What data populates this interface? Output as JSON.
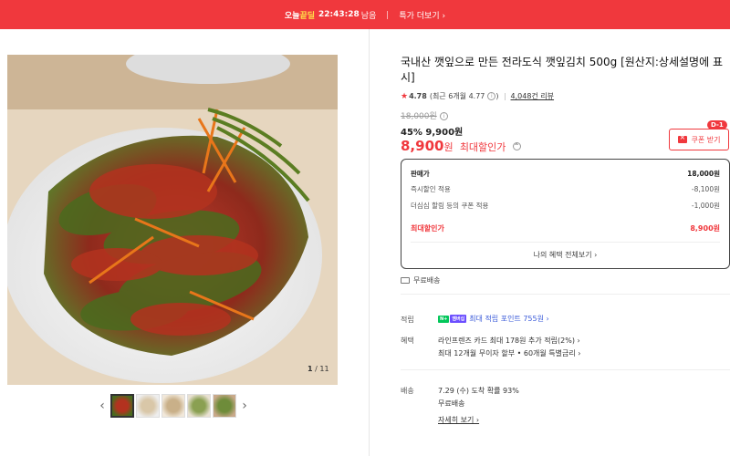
{
  "banner": {
    "brand_prefix": "오늘",
    "brand_highlight": "끝딜",
    "timer": "22:43:28",
    "timer_suffix": "남음",
    "more_link": "특가 더보기 ›"
  },
  "gallery": {
    "counter_current": "1",
    "counter_total": "/ 11",
    "thumb_count": 5
  },
  "product": {
    "title": "국내산 깻잎으로 만든 전라도식 깻잎김치 500g [원산지:상세설명에 표시]",
    "rating": "4.78",
    "rating_recent": "(최근 6개월 4.77",
    "rating_recent_close": ")",
    "reviews": "4,048건 리뷰",
    "original_price": "18,000원",
    "discount_percent": "45%",
    "discount_price": "9,900원",
    "max_price_value": "8,900",
    "max_price_unit": "원",
    "max_price_label": "최대할인가"
  },
  "coupon": {
    "label": "쿠폰 받기",
    "dday": "D-1"
  },
  "price_box": {
    "rows": [
      {
        "label": "판매가",
        "value": "18,000원"
      },
      {
        "label": "즉시할인 적용",
        "value": "-8,100원"
      },
      {
        "label": "더심심 할림 등의 쿠폰 적용",
        "value": "-1,000원"
      },
      {
        "label": "최대할인가",
        "value": "8,900원"
      }
    ],
    "link": "나의 혜택 전체보기 ›"
  },
  "shipping_badge": "무료배송",
  "benefits": {
    "points_label": "적립",
    "points_tag1": "N+",
    "points_tag2": "멤버십",
    "points_text": "최대 적립 포인트 755원 ›",
    "perks_label": "혜택",
    "perks_line1": "라인프렌즈 카드 최대 178원 추가 적립(2%) ›",
    "perks_line2": "최대 12개월 무이자 할부 • 60개월 특별금리 ›"
  },
  "delivery": {
    "label": "배송",
    "line1": "7.29 (수) 도착 확률 93%",
    "line2": "무료배송",
    "link": "자세히 보기 ›"
  },
  "colors": {
    "accent": "#f0383d",
    "naver_green": "#03c75a",
    "points_blue": "#3b5bd9"
  }
}
